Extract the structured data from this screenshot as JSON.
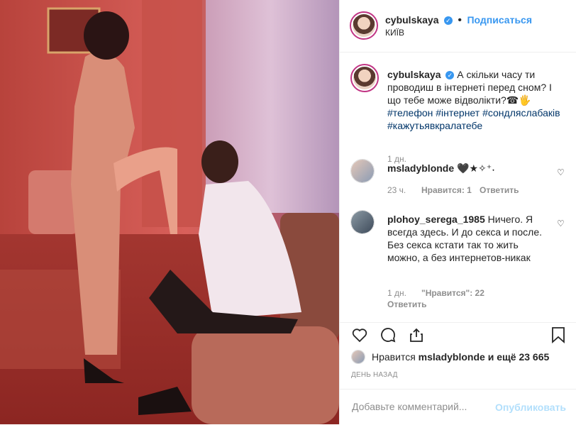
{
  "header": {
    "username": "cybulskaya",
    "follow_label": "Подписаться",
    "location": "КИЇВ",
    "verified_icon": "verified-badge-icon"
  },
  "caption": {
    "username": "cybulskaya",
    "text": "А скільки часу ти проводиш в інтернеті перед сном? І що тебе може відволікти?☎︎🖐",
    "hashtags": [
      "#телефон",
      "#інтернет",
      "#сондляслабаків",
      "#кажутьявкралатебе"
    ],
    "time": "1 дн."
  },
  "comments": [
    {
      "username": "msladyblonde",
      "text": "🖤★✧⁺˖",
      "time": "23 ч.",
      "likes": "Нравится: 1",
      "reply": "Ответить"
    },
    {
      "username": "plohoy_serega_1985",
      "text": "Ничего. Я всегда здесь. И до секса и после. Без секса кстати так то жить можно, а без интернетов-никак",
      "time": "1 дн.",
      "likes": "\"Нравится\": 22",
      "reply": "Ответить"
    }
  ],
  "likes_line": {
    "prefix": "Нравится",
    "user": "msladyblonde",
    "suffix": "и ещё 23 665"
  },
  "posted_ago": "ДЕНЬ НАЗАД",
  "add_comment": {
    "placeholder": "Добавьте комментарий...",
    "publish_label": "Опубликовать"
  },
  "colors": {
    "accent": "#3897f0",
    "text": "#262626",
    "muted": "#8e8e8e",
    "photo_red": "#c0403a"
  }
}
